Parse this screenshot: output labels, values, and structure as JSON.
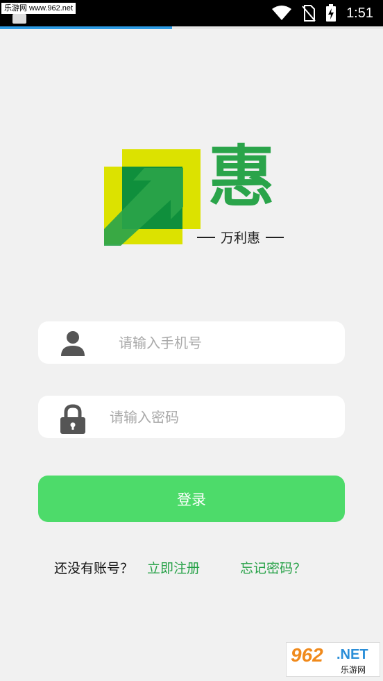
{
  "status_bar": {
    "watermark_text": "乐游网 www.962.net",
    "time": "1:51",
    "icons": [
      "wifi-icon",
      "no-sim-icon",
      "battery-charging-icon"
    ]
  },
  "page_progress": {
    "percent": 45,
    "color": "#2d9be4"
  },
  "logo": {
    "character": "惠",
    "subtitle": "万利惠",
    "colors": {
      "green": "#2aa44a",
      "yellow": "#dce200",
      "dark_green": "#0f8f3c"
    }
  },
  "form": {
    "phone": {
      "placeholder": "请输入手机号",
      "value": "",
      "icon": "user-icon"
    },
    "password": {
      "placeholder": "请输入密码",
      "value": "",
      "icon": "lock-icon"
    },
    "login_button": {
      "label": "登录",
      "color": "#4ddb6a"
    }
  },
  "links": {
    "no_account": "还没有账号？",
    "register": "立即注册",
    "forgot_password": "忘记密码？",
    "accent_color": "#26a147"
  },
  "watermark": {
    "number": "962",
    "suffix": ".NET",
    "cn": "乐游网"
  }
}
